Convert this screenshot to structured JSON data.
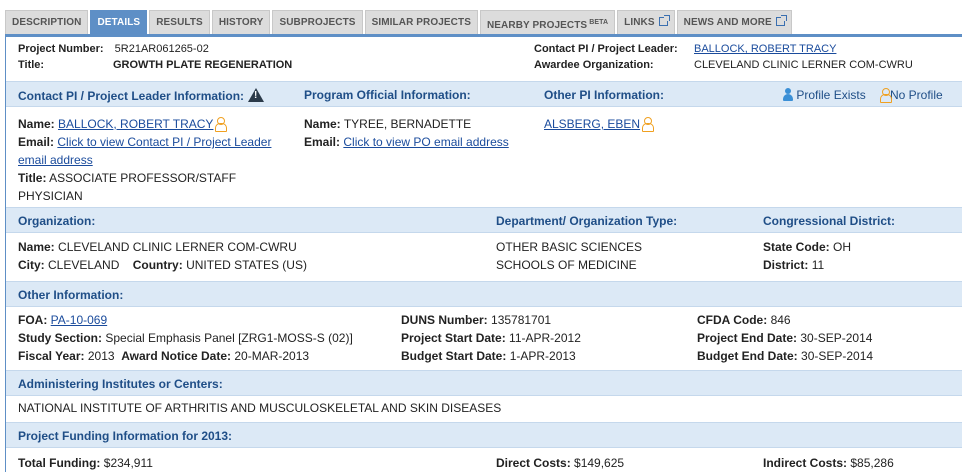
{
  "tabs": [
    {
      "label": "DESCRIPTION",
      "active": false
    },
    {
      "label": "DETAILS",
      "active": true
    },
    {
      "label": "RESULTS",
      "active": false
    },
    {
      "label": "HISTORY",
      "active": false
    },
    {
      "label": "SUBPROJECTS",
      "active": false
    },
    {
      "label": "SIMILAR PROJECTS",
      "active": false
    },
    {
      "label": "NEARBY PROJECTS",
      "sup": "BETA",
      "active": false
    },
    {
      "label": "LINKS",
      "external": true,
      "active": false
    },
    {
      "label": "NEWS AND MORE",
      "external": true,
      "active": false
    }
  ],
  "summary": {
    "project_number_label": "Project Number:",
    "project_number": "5R21AR061265-02",
    "title_label": "Title:",
    "title": "GROWTH PLATE REGENERATION",
    "contact_pi_label": "Contact PI / Project Leader:",
    "contact_pi": "BALLOCK, ROBERT TRACY",
    "awardee_label": "Awardee Organization:",
    "awardee": "CLEVELAND CLINIC LERNER COM-CWRU"
  },
  "people": {
    "contact_head": "Contact PI / Project Leader Information:",
    "po_head": "Program Official Information:",
    "other_head": "Other PI Information:",
    "profile_exists": "Profile Exists",
    "no_profile": "No Profile",
    "contact_name_label": "Name:",
    "contact_name": "BALLOCK, ROBERT TRACY",
    "contact_email_label": "Email:",
    "contact_email_link_1": "Click to view Contact PI / Project Leader",
    "contact_email_link_2": "email address",
    "contact_title_label": "Title:",
    "contact_title_1": "ASSOCIATE PROFESSOR/STAFF",
    "contact_title_2": "PHYSICIAN",
    "po_name_label": "Name:",
    "po_name": "TYREE, BERNADETTE",
    "po_email_label": "Email:",
    "po_email_link": "Click to view PO email address",
    "other_pi": "ALSBERG, EBEN"
  },
  "organization": {
    "org_head": "Organization:",
    "dept_head": "Department/ Organization Type:",
    "district_head": "Congressional District:",
    "name_label": "Name:",
    "name": "CLEVELAND CLINIC LERNER COM-CWRU",
    "city_label": "City:",
    "city": "CLEVELAND",
    "country_label": "Country:",
    "country": "UNITED STATES (US)",
    "dept_1": "OTHER BASIC SCIENCES",
    "dept_2": "SCHOOLS OF MEDICINE",
    "state_label": "State Code:",
    "state": "OH",
    "district_label": "District:",
    "district": "11"
  },
  "other": {
    "head": "Other Information:",
    "foa_label": "FOA:",
    "foa": "PA-10-069",
    "study_label": "Study Section:",
    "study": "Special Emphasis Panel [ZRG1-MOSS-S (02)]",
    "fy_label": "Fiscal Year:",
    "fy": "2013",
    "award_label": "Award Notice Date:",
    "award": "20-MAR-2013",
    "duns_label": "DUNS Number:",
    "duns": "135781701",
    "start_label": "Project Start Date:",
    "start": "11-APR-2012",
    "bstart_label": "Budget Start Date:",
    "bstart": "1-APR-2013",
    "cfda_label": "CFDA Code:",
    "cfda": "846",
    "end_label": "Project End Date:",
    "end": "30-SEP-2014",
    "bend_label": "Budget End Date:",
    "bend": "30-SEP-2014"
  },
  "institutes": {
    "head": "Administering Institutes or Centers:",
    "name": "NATIONAL INSTITUTE OF ARTHRITIS AND MUSCULOSKELETAL AND SKIN DISEASES"
  },
  "funding": {
    "head": "Project Funding Information for 2013:",
    "total_label": "Total Funding:",
    "total": "$234,911",
    "direct_label": "Direct Costs:",
    "direct": "$149,625",
    "indirect_label": "Indirect Costs:",
    "indirect": "$85,286"
  }
}
